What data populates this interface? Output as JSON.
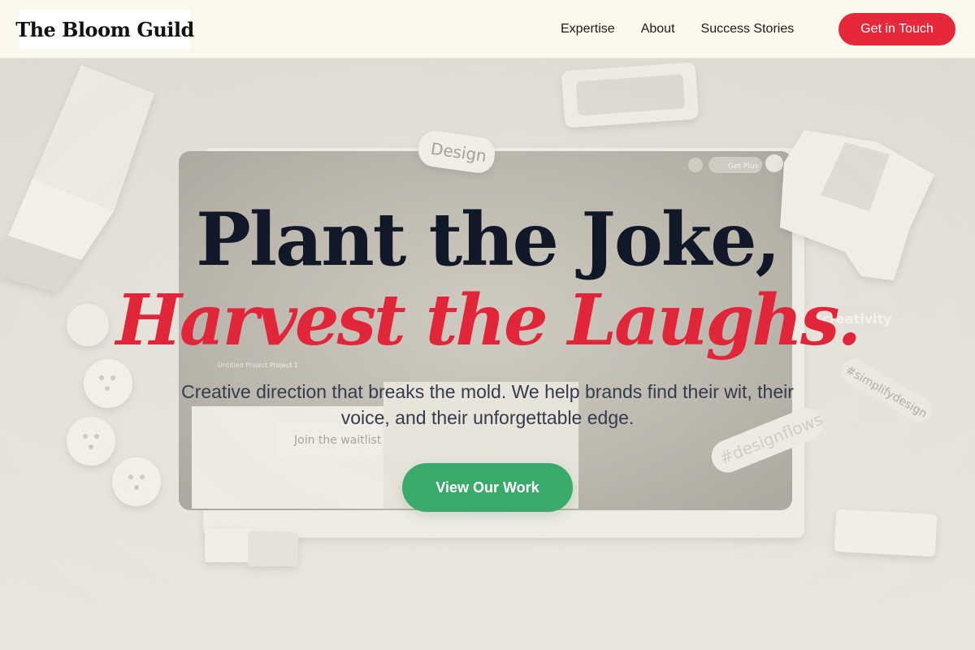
{
  "brand": {
    "logo_text": "The Bloom Guild"
  },
  "nav": {
    "items": [
      {
        "label": "Expertise"
      },
      {
        "label": "About"
      },
      {
        "label": "Success Stories"
      }
    ],
    "cta_label": "Get in Touch"
  },
  "hero": {
    "headline_line1": "Plant the Joke,",
    "headline_line2": "Harvest the Laughs.",
    "subtext": "Creative direction that breaks the mold. We help brands find their wit, their voice, and their unforgettable edge.",
    "cta_label": "View Our Work"
  },
  "background_scene": {
    "tags": {
      "design": "Design",
      "creativity": "#creativity",
      "simplify": "#simplifydesign",
      "designflows": "#designflows"
    },
    "mock_ui_texts": {
      "get_plus": "Get Plus",
      "join_waitlist": "Join the waitlist",
      "project": "Project 1",
      "untitled": "Untitled Project"
    }
  },
  "colors": {
    "accent_red": "#e5283a",
    "cta_green": "#3aaa6a",
    "header_bg": "#fbf8ee",
    "headline_dark": "#111827"
  }
}
